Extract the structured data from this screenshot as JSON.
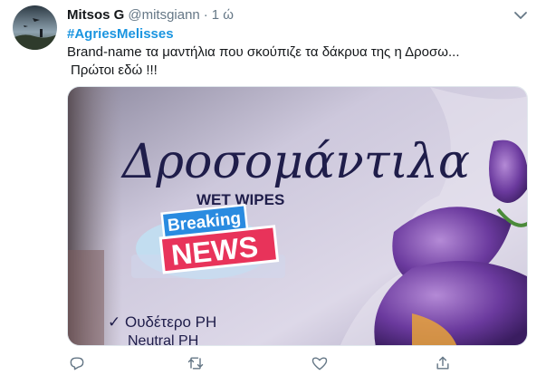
{
  "tweet": {
    "author_name": "Mitsos G",
    "handle": "@mitsgiann",
    "separator": "·",
    "time": "1 ώ",
    "hashtag": "#AgriesMelisses",
    "text_line1": "Brand-name τα μαντήλια που σκούπιζε τα δάκρυα της η Δροσω...",
    "text_line2": "Πρώτοι εδώ !!!"
  },
  "media": {
    "brand_text": "Δροσομάντιλα",
    "subtitle": "WET WIPES",
    "breaking_label": "Breaking",
    "news_label": "NEWS",
    "feature1": "✓ Ουδέτερο PH",
    "feature2": "Neutral PH",
    "colors": {
      "package_bg": "#c9c3d9",
      "brand_text": "#1f1d4a",
      "breaking_bg": "#2a8be0",
      "news_bg": "#e8335a",
      "flower": "#6b3a9e"
    }
  },
  "icons": {
    "avatar": "avatar-image",
    "caret": "chevron-down-icon",
    "reply": "reply-icon",
    "retweet": "retweet-icon",
    "like": "heart-icon",
    "share": "share-icon"
  }
}
